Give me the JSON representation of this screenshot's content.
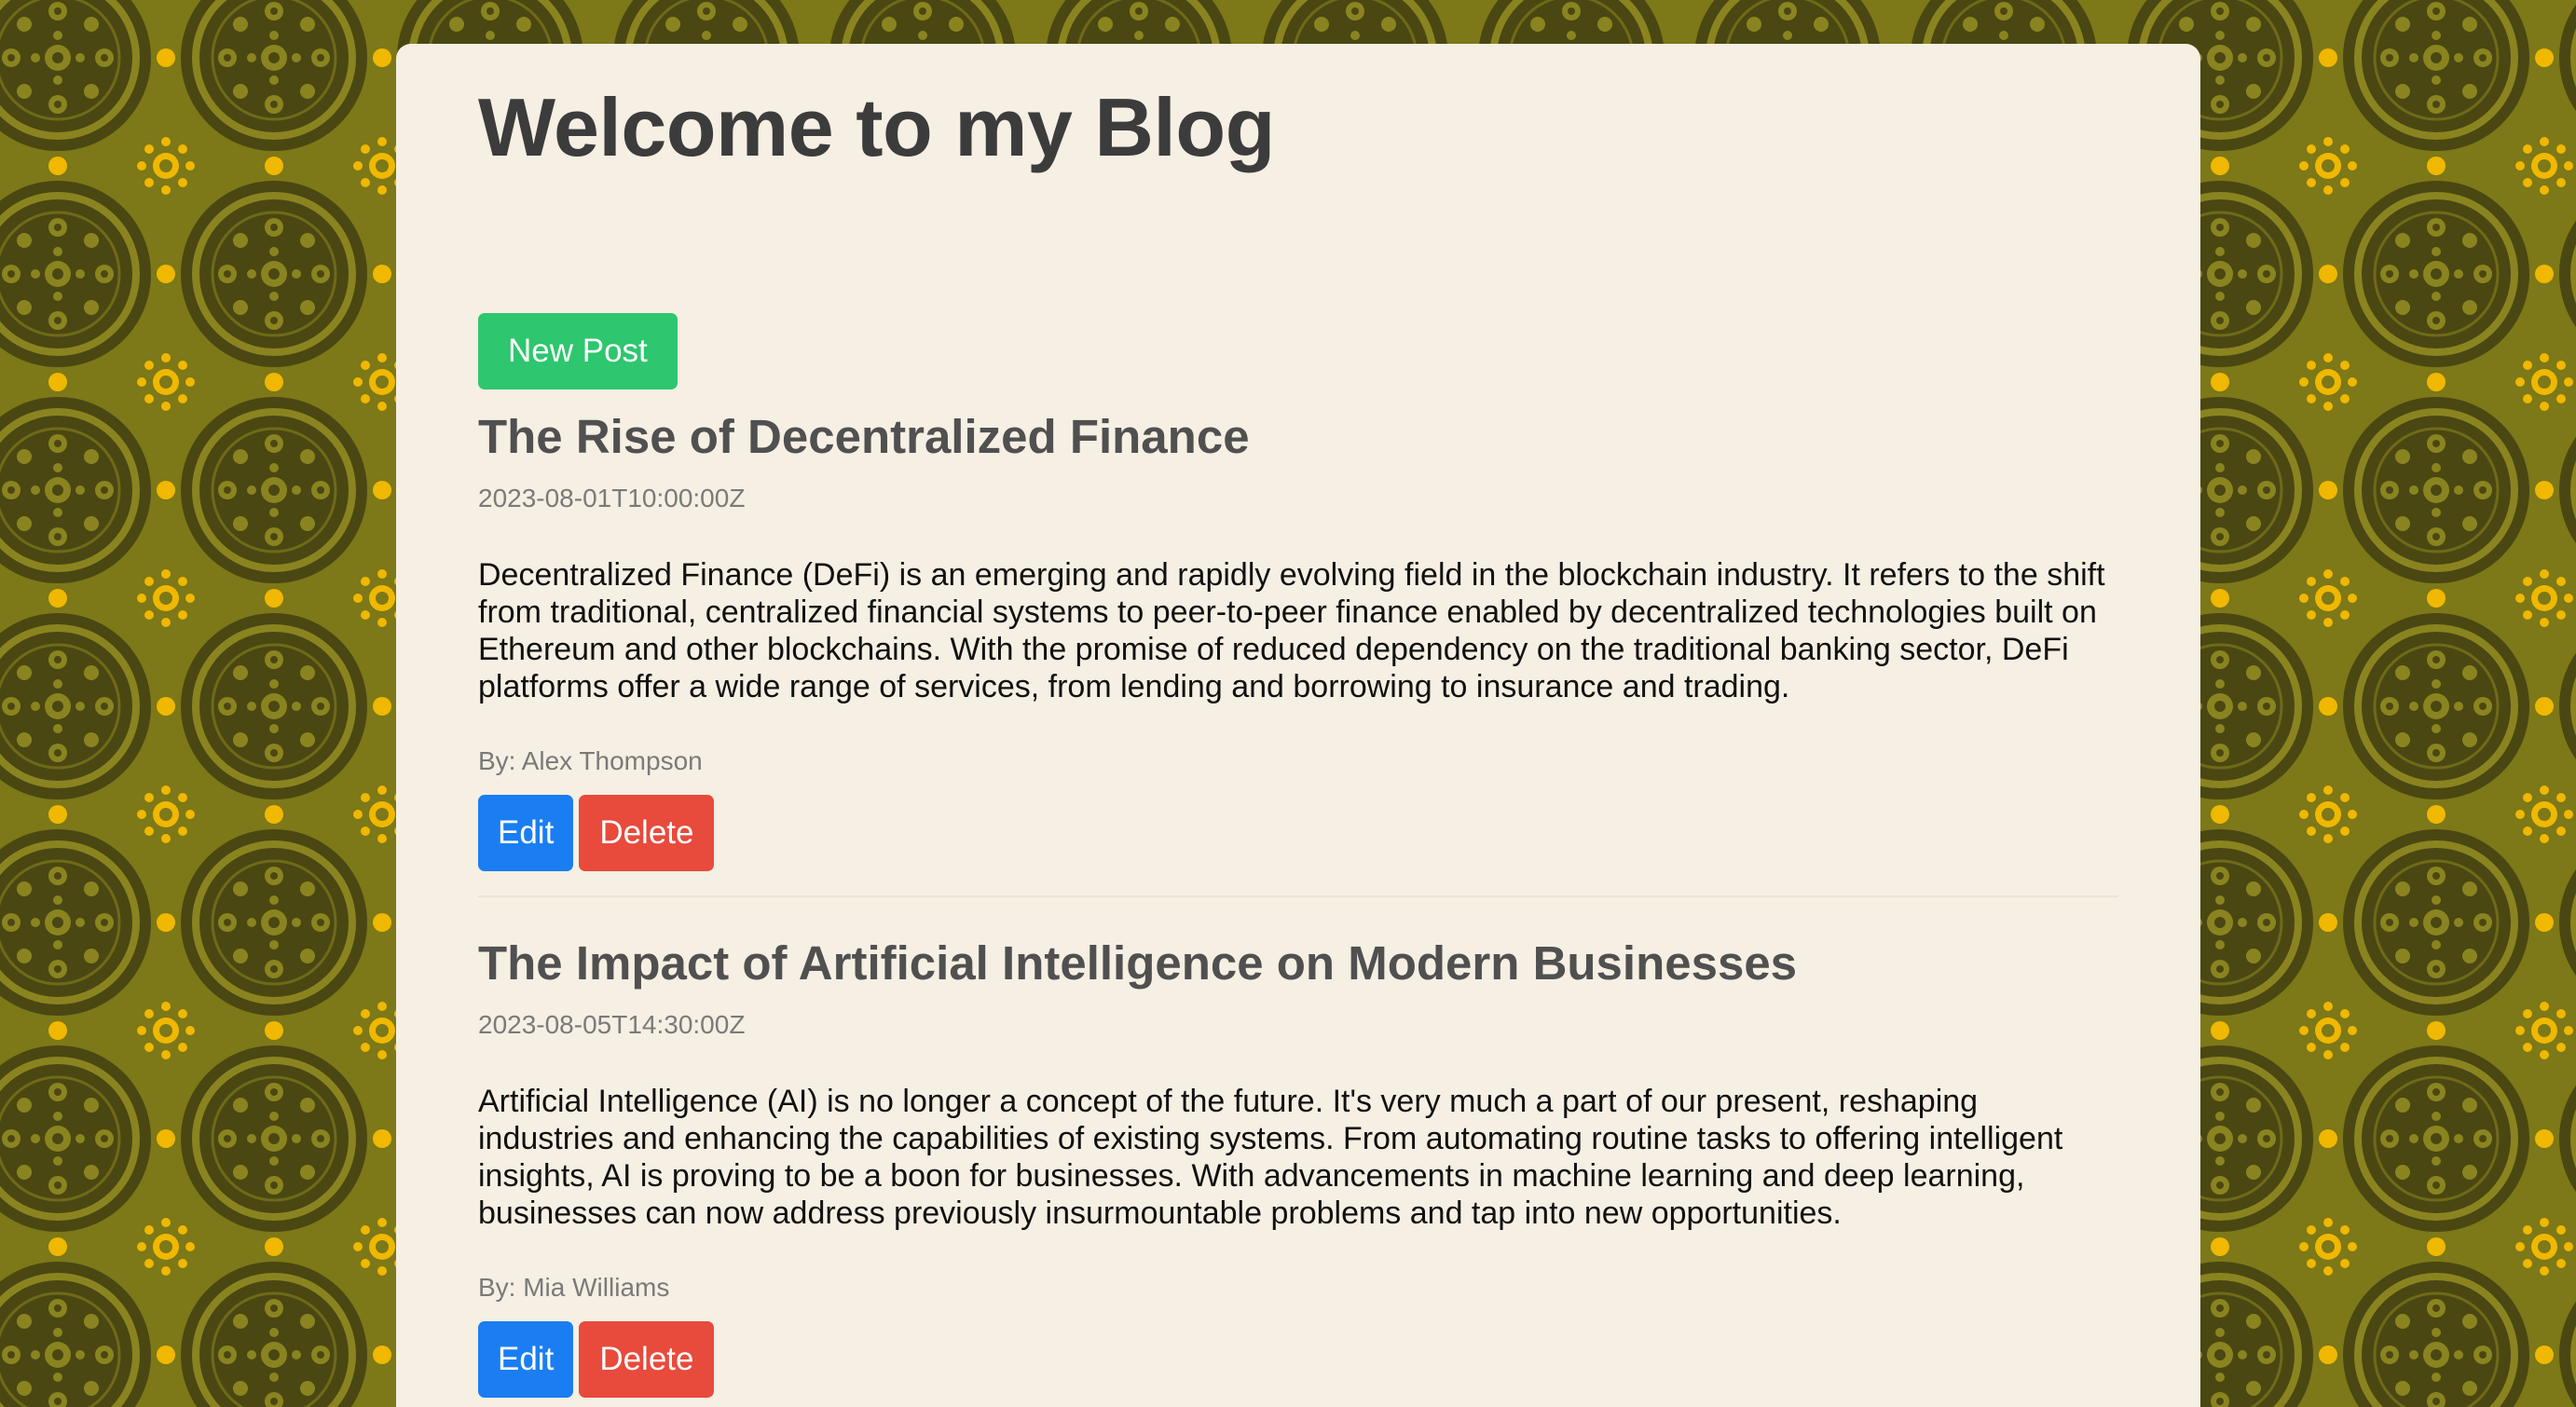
{
  "page": {
    "title": "Welcome to my Blog",
    "new_post_label": "New Post"
  },
  "posts": [
    {
      "title": "The Rise of Decentralized Finance",
      "date": "2023-08-01T10:00:00Z",
      "body": "Decentralized Finance (DeFi) is an emerging and rapidly evolving field in the blockchain industry. It refers to the shift from traditional, centralized financial systems to peer-to-peer finance enabled by decentralized technologies built on Ethereum and other blockchains. With the promise of reduced dependency on the traditional banking sector, DeFi platforms offer a wide range of services, from lending and borrowing to insurance and trading.",
      "author": "By: Alex Thompson",
      "edit_label": "Edit",
      "delete_label": "Delete"
    },
    {
      "title": "The Impact of Artificial Intelligence on Modern Businesses",
      "date": "2023-08-05T14:30:00Z",
      "body": "Artificial Intelligence (AI) is no longer a concept of the future. It's very much a part of our present, reshaping industries and enhancing the capabilities of existing systems. From automating routine tasks to offering intelligent insights, AI is proving to be a boon for businesses. With advancements in machine learning and deep learning, businesses can now address previously insurmountable problems and tap into new opportunities.",
      "author": "By: Mia Williams",
      "edit_label": "Edit",
      "delete_label": "Delete"
    }
  ],
  "colors": {
    "background_pattern_dark": "#4a4712",
    "background_pattern_mid": "#8a8420",
    "background_pattern_accent": "#f0b800",
    "card": "#f6efe3",
    "new_post_button": "#2ec66e",
    "edit_button": "#1a7ef2",
    "delete_button": "#e84a3c"
  }
}
